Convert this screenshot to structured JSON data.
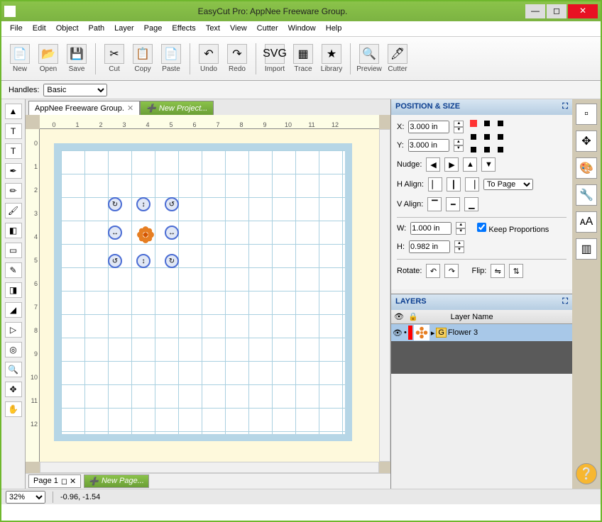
{
  "window": {
    "title": "EasyCut Pro: AppNee Freeware Group."
  },
  "menu": [
    "File",
    "Edit",
    "Object",
    "Path",
    "Layer",
    "Page",
    "Effects",
    "Text",
    "View",
    "Cutter",
    "Window",
    "Help"
  ],
  "toolbar": [
    {
      "label": "New",
      "icon": "📄"
    },
    {
      "label": "Open",
      "icon": "📂"
    },
    {
      "label": "Save",
      "icon": "💾"
    },
    {
      "div": true
    },
    {
      "label": "Cut",
      "icon": "✂"
    },
    {
      "label": "Copy",
      "icon": "📋"
    },
    {
      "label": "Paste",
      "icon": "📄"
    },
    {
      "div": true
    },
    {
      "label": "Undo",
      "icon": "↶"
    },
    {
      "label": "Redo",
      "icon": "↷"
    },
    {
      "div": true
    },
    {
      "label": "Import",
      "icon": "SVG"
    },
    {
      "label": "Trace",
      "icon": "▦"
    },
    {
      "label": "Library",
      "icon": "★"
    },
    {
      "div": true
    },
    {
      "label": "Preview",
      "icon": "🔍"
    },
    {
      "label": "Cutter",
      "icon": "🖊"
    }
  ],
  "handles": {
    "label": "Handles:",
    "value": "Basic"
  },
  "doctabs": [
    {
      "label": "AppNee Freeware Group.",
      "active": true
    },
    {
      "label": "New Project...",
      "special": "green"
    }
  ],
  "ruler_h": [
    "0",
    "1",
    "2",
    "3",
    "4",
    "5",
    "6",
    "7",
    "8",
    "9",
    "10",
    "11",
    "12"
  ],
  "ruler_v": [
    "0",
    "1",
    "2",
    "3",
    "4",
    "5",
    "6",
    "7",
    "8",
    "9",
    "10",
    "11",
    "12"
  ],
  "leftTools": [
    "▲",
    "T",
    "T",
    "✒",
    "✏",
    "🖌",
    "◧",
    "▭",
    "✎",
    "◨",
    "◢",
    "▷",
    "◎",
    "🔍",
    "✥",
    "✋"
  ],
  "postsize": {
    "title": "POSITION & SIZE",
    "x_label": "X:",
    "x": "3.000 in",
    "y_label": "Y:",
    "y": "3.000 in",
    "nudge": "Nudge:",
    "halign": "H Align:",
    "valign": "V Align:",
    "toPage": "To Page",
    "w_label": "W:",
    "w": "1.000 in",
    "h_label": "H:",
    "h": "0.982 in",
    "keep": "Keep Proportions",
    "rotate": "Rotate:",
    "flip": "Flip:"
  },
  "layers": {
    "title": "LAYERS",
    "headerName": "Layer Name",
    "items": [
      {
        "name": "Flower 3",
        "group": "G"
      }
    ]
  },
  "pagestrip": {
    "page": "Page 1",
    "new": "New Page..."
  },
  "status": {
    "zoom": "32%",
    "coords": "-0.96, -1.54"
  },
  "rside": [
    "▫",
    "✥",
    "🎨",
    "🔧",
    "ᴀA",
    "▥",
    "❔"
  ]
}
